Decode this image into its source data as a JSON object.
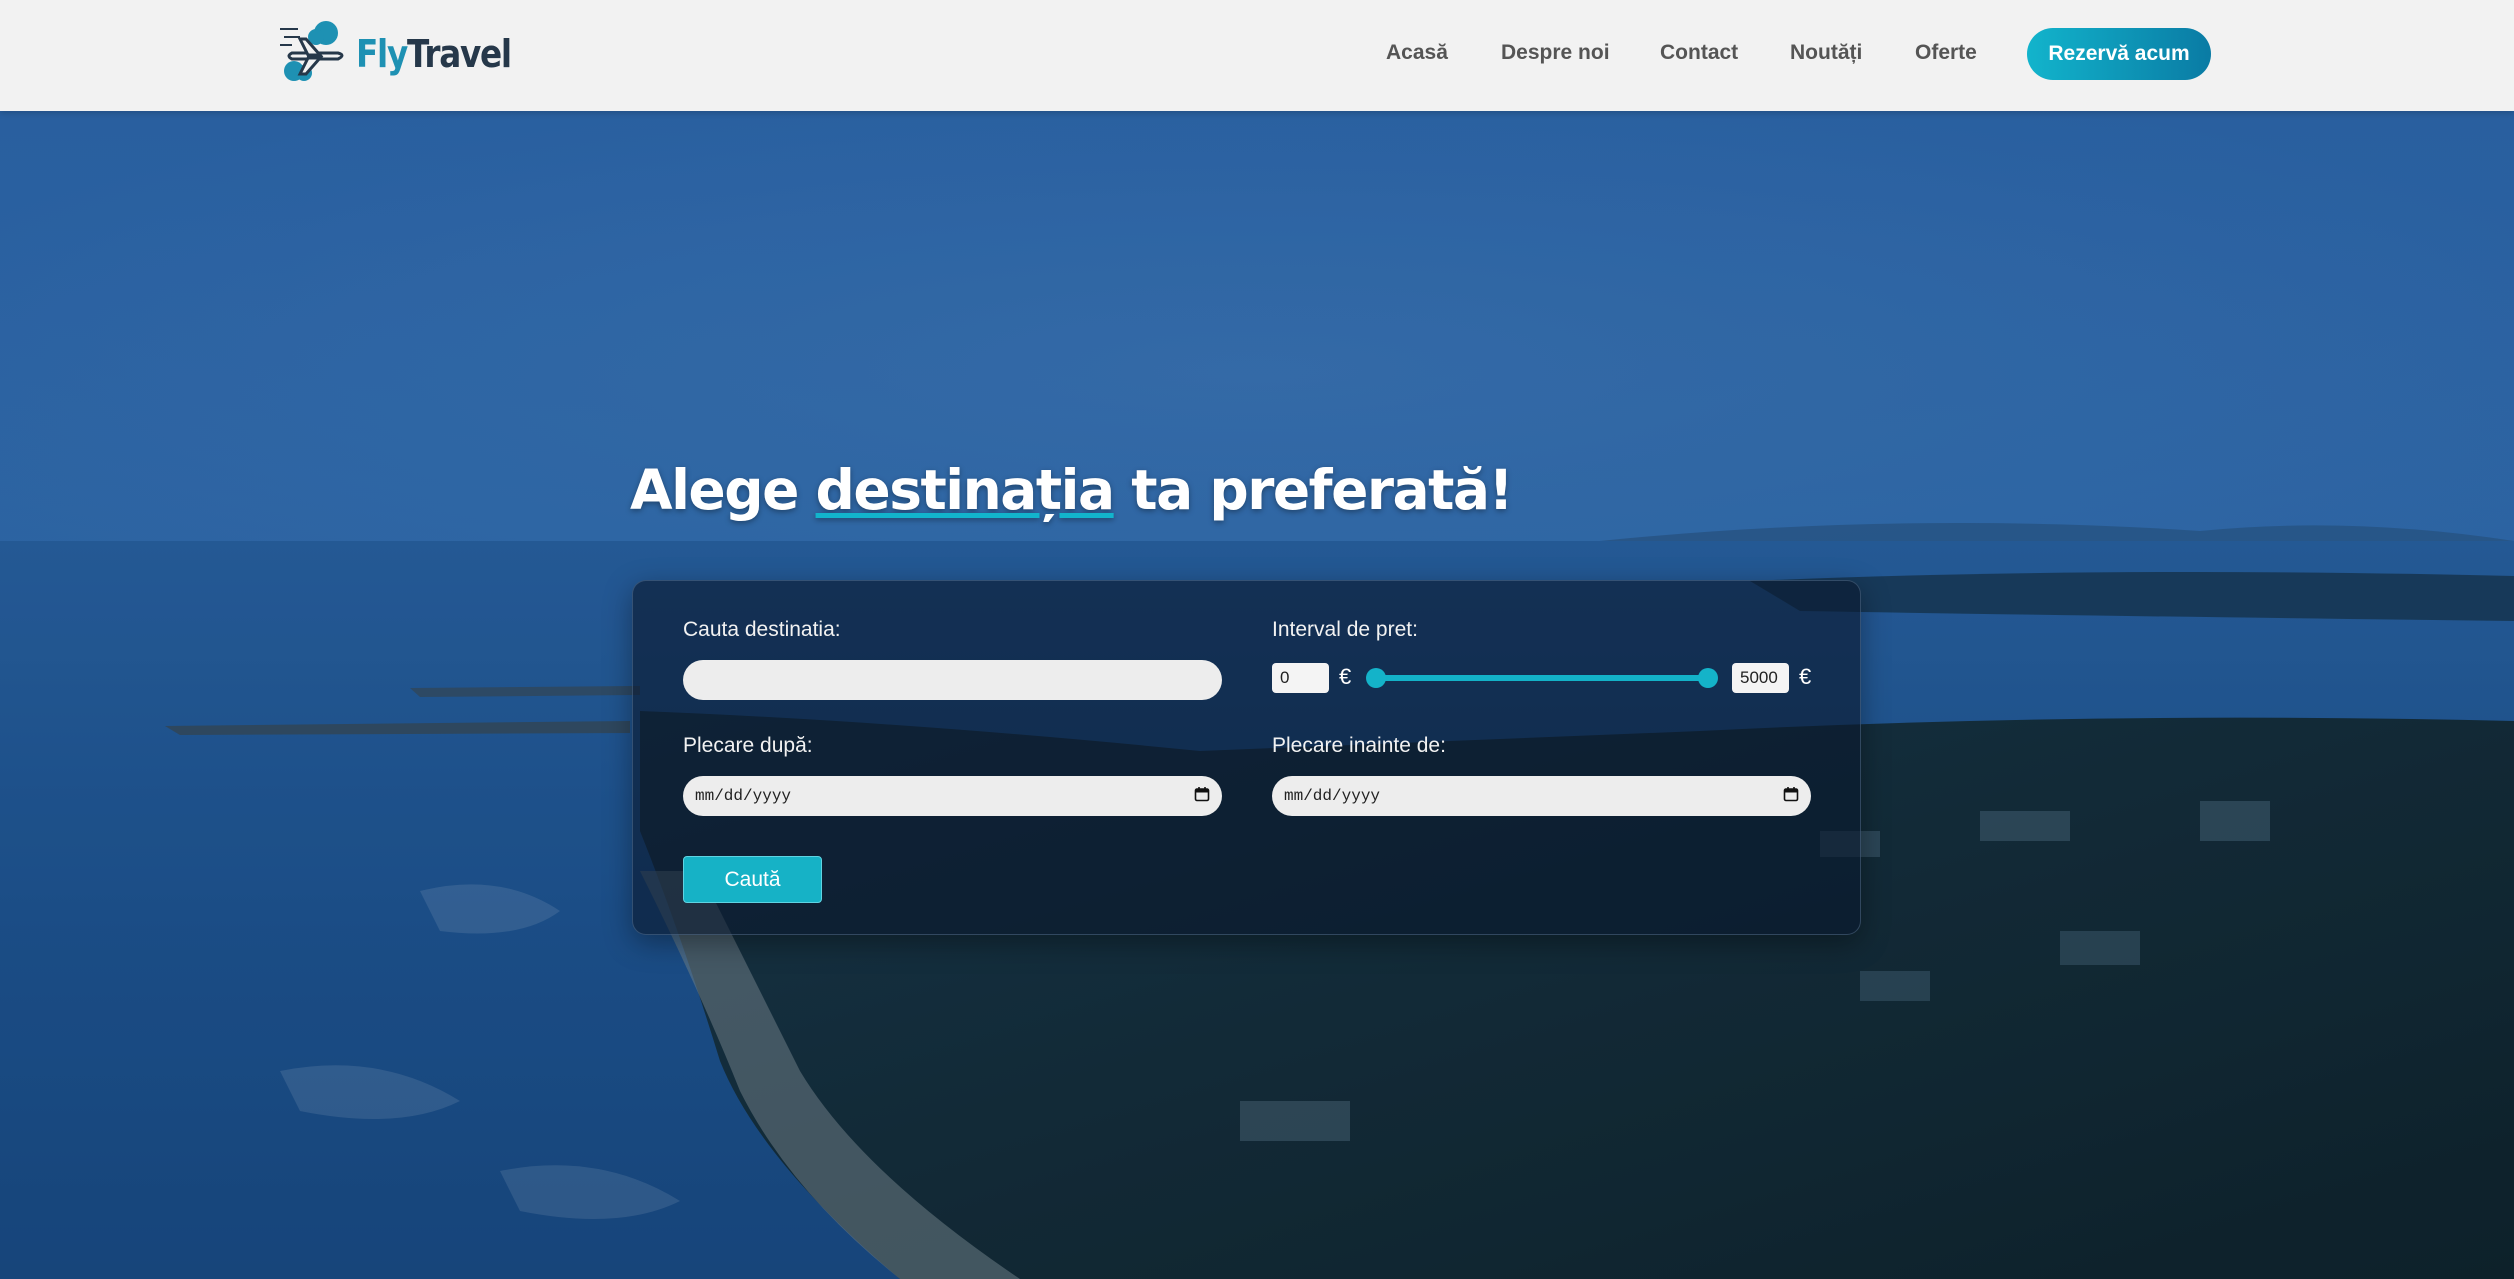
{
  "brand": {
    "name_part1": "Fly",
    "name_part2": "Travel",
    "logo_icon": "plane-cloud-logo-icon"
  },
  "nav": {
    "items": [
      {
        "label": "Acasă"
      },
      {
        "label": "Despre noi"
      },
      {
        "label": "Contact"
      },
      {
        "label": "Noutăți"
      },
      {
        "label": "Oferte"
      }
    ],
    "cta_label": "Rezervă acum"
  },
  "hero": {
    "heading_before": "Alege ",
    "heading_highlight": "destinația",
    "heading_after": " ta preferată!"
  },
  "search": {
    "destination_label": "Cauta destinatia:",
    "destination_value": "",
    "price_label": "Interval de pret:",
    "price_min": "0",
    "price_max": "5000",
    "currency": "€",
    "slider_min_fraction": 0,
    "slider_max_fraction": 1,
    "depart_after_label": "Plecare după:",
    "depart_after_value": "mm/dd/yyyy",
    "depart_before_label": "Plecare inainte de:",
    "depart_before_value": "mm/dd/yyyy",
    "submit_label": "Caută"
  },
  "colors": {
    "accent": "#12b4cc",
    "accent_dark": "#0a7ba4",
    "header_bg": "#f2f2f2",
    "brand_dark": "#26384a"
  }
}
